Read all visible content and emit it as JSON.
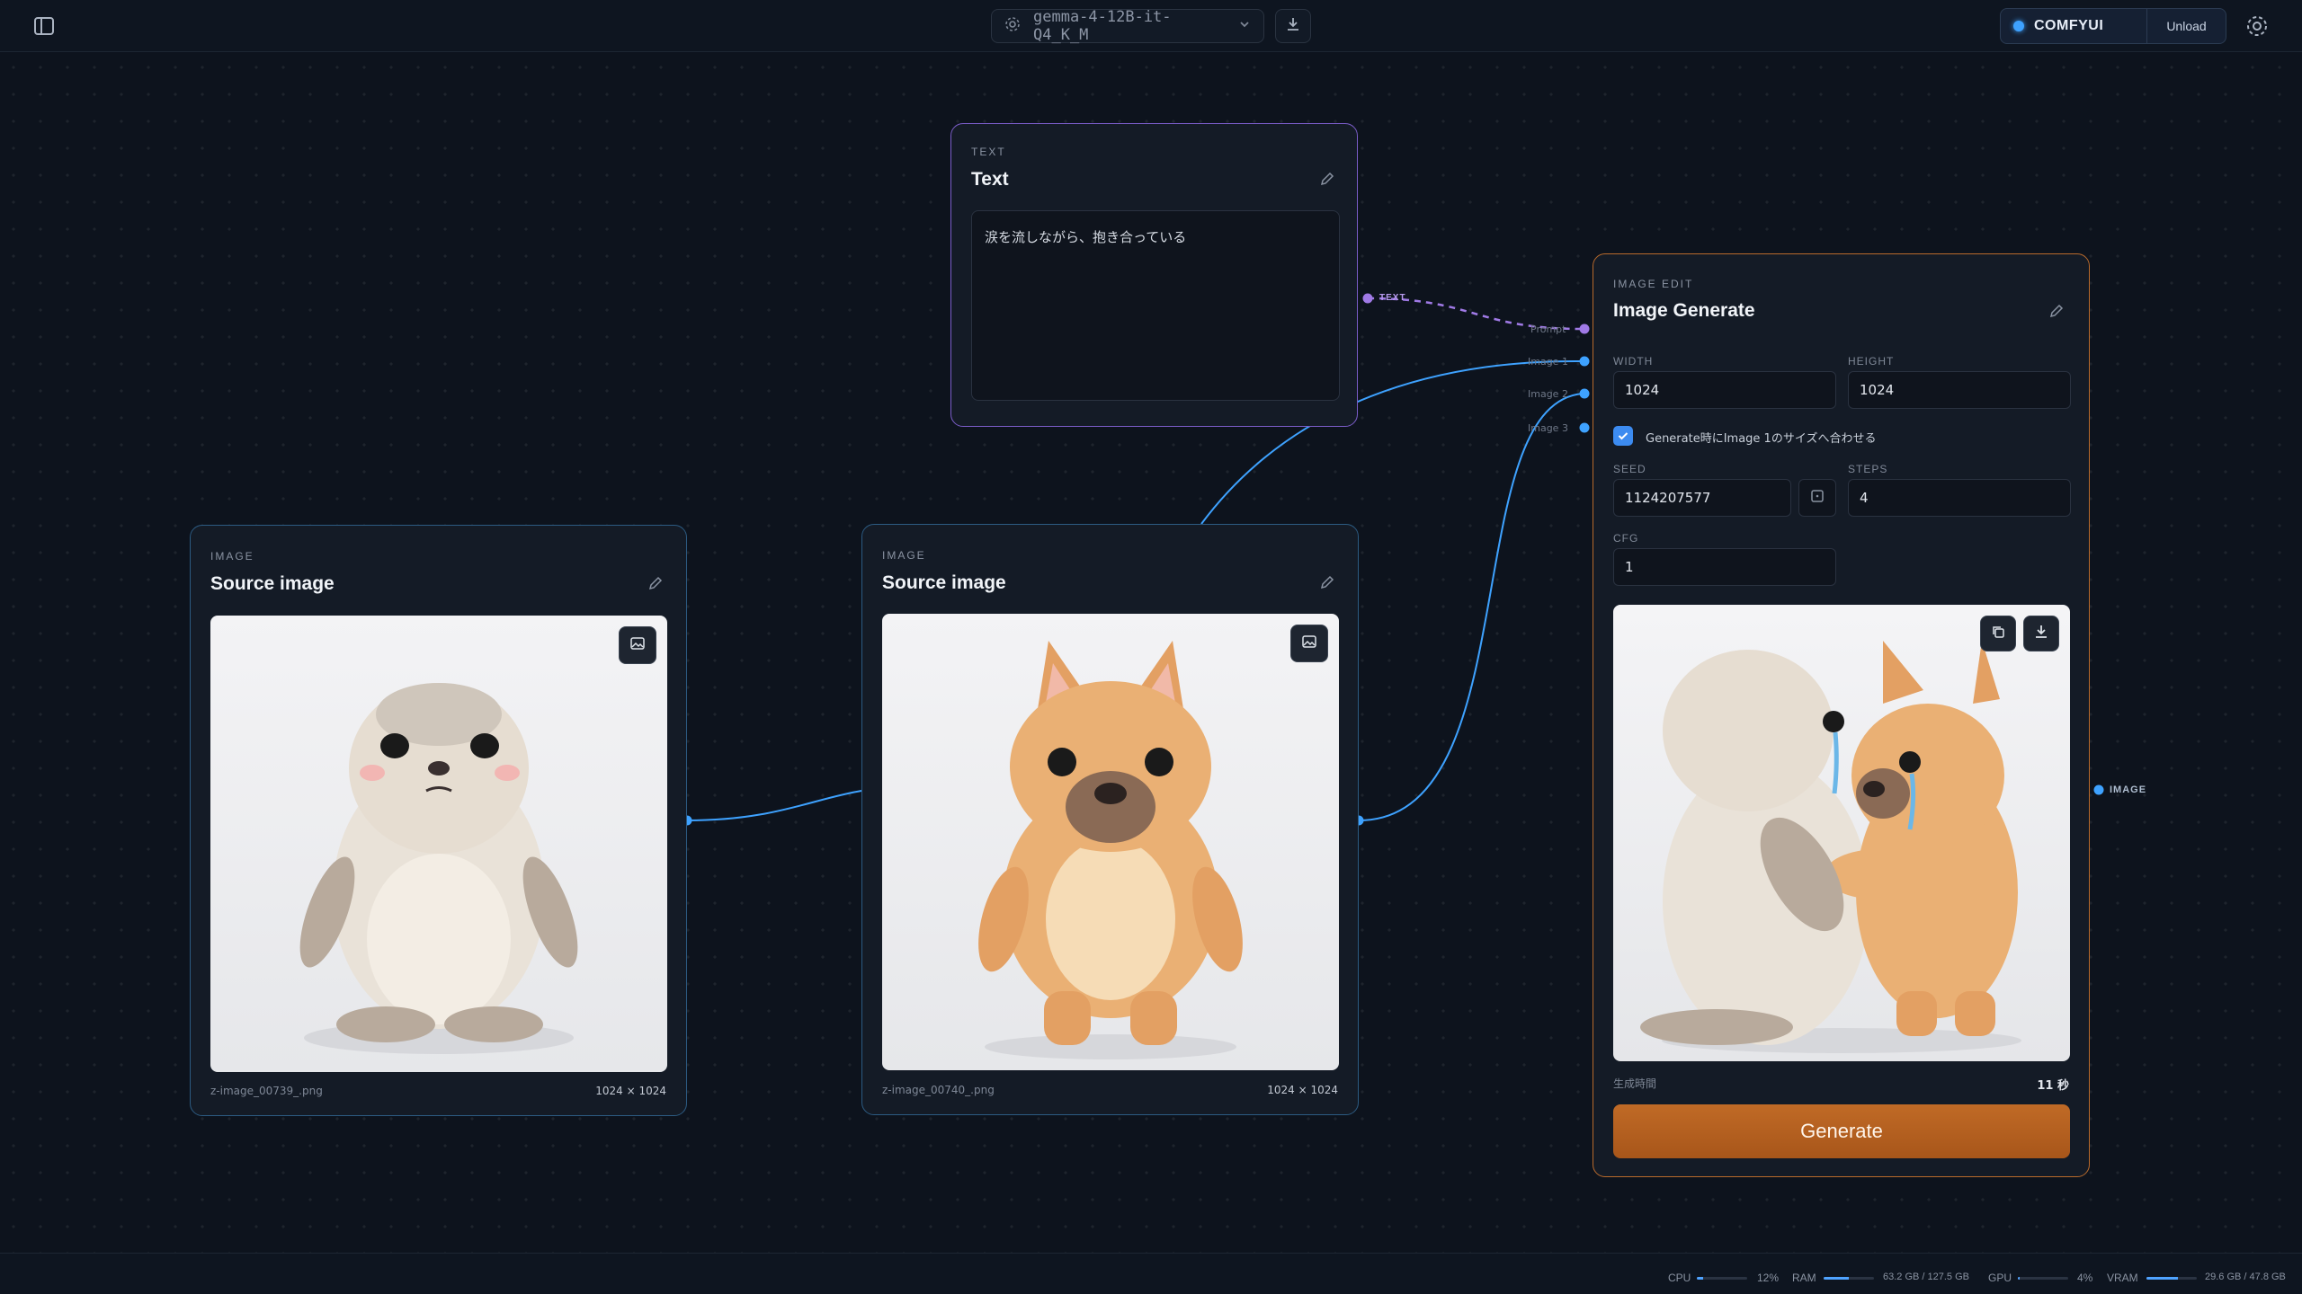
{
  "header": {
    "model_name": "gemma-4-12B-it-Q4_K_M",
    "backend_label": "COMFYUI",
    "unload_label": "Unload"
  },
  "text_node": {
    "kind": "TEXT",
    "title": "Text",
    "content": "涙を流しながら、抱き合っている",
    "output_port": "TEXT"
  },
  "image_node_1": {
    "kind": "IMAGE",
    "title": "Source image",
    "filename": "z-image_00739_.png",
    "dimensions": "1024 × 1024"
  },
  "image_node_2": {
    "kind": "IMAGE",
    "title": "Source image",
    "filename": "z-image_00740_.png",
    "dimensions": "1024 × 1024"
  },
  "generate_node": {
    "kind": "IMAGE EDIT",
    "title": "Image Generate",
    "inputs": [
      "Prompt",
      "Image 1",
      "Image 2",
      "Image 3"
    ],
    "width_label": "WIDTH",
    "width_value": "1024",
    "height_label": "HEIGHT",
    "height_value": "1024",
    "match_size_label": "Generate時にImage 1のサイズへ合わせる",
    "match_size_checked": true,
    "seed_label": "SEED",
    "seed_value": "1124207577",
    "steps_label": "STEPS",
    "steps_value": "4",
    "cfg_label": "CFG",
    "cfg_value": "1",
    "gen_time_label": "生成時間",
    "gen_time_value": "11 秒",
    "generate_label": "Generate",
    "output_port": "IMAGE"
  },
  "status": {
    "cpu_label": "CPU",
    "cpu_value": "12%",
    "cpu_fraction": 0.12,
    "ram_label": "RAM",
    "ram_value": "63.2 GB / 127.5 GB",
    "ram_fraction": 0.5,
    "gpu_label": "GPU",
    "gpu_value": "4%",
    "gpu_fraction": 0.04,
    "vram_label": "VRAM",
    "vram_value": "29.6 GB / 47.8 GB",
    "vram_fraction": 0.62
  },
  "colors": {
    "text_accent": "#9b6cf0",
    "image_accent": "#3ea2ff",
    "generate_accent": "#c06a26"
  }
}
